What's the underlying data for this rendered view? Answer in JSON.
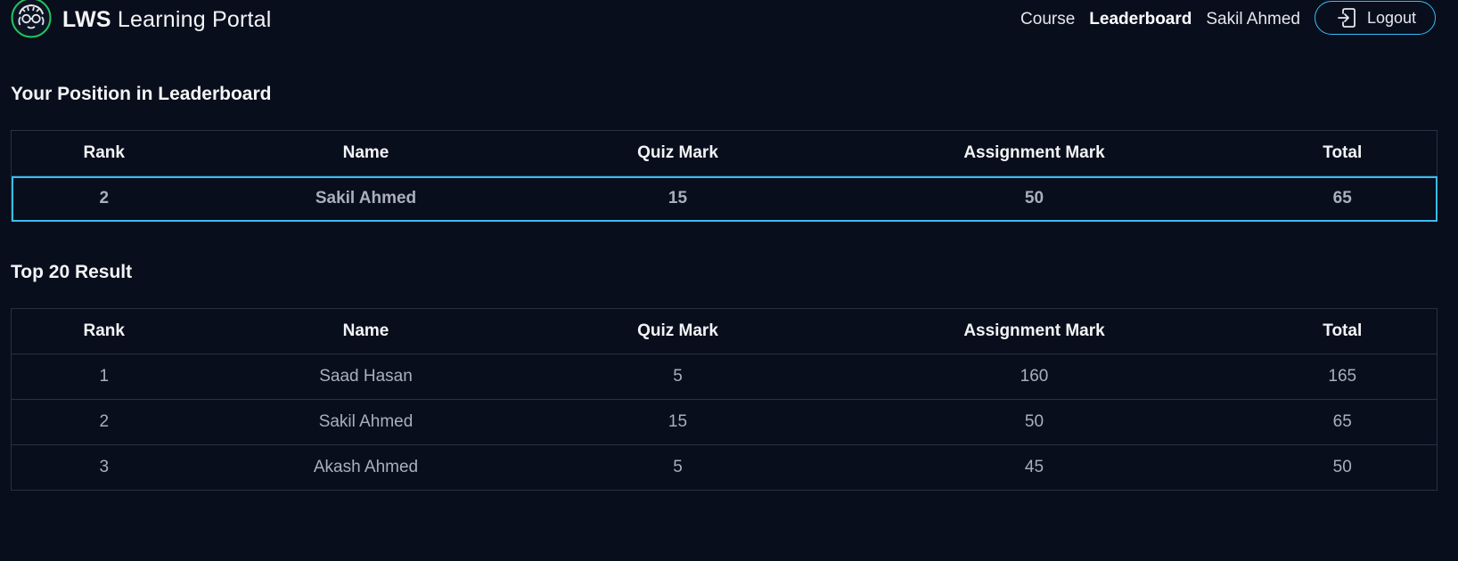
{
  "header": {
    "brand_bold": "LWS",
    "brand_rest": "Learning Portal",
    "logo_icon": "nerd-face-logo-icon",
    "nav": {
      "course_label": "Course",
      "leaderboard_label": "Leaderboard",
      "user_name": "Sakil Ahmed",
      "logout_label": "Logout"
    }
  },
  "position_section": {
    "title": "Your Position in Leaderboard",
    "columns": [
      "Rank",
      "Name",
      "Quiz Mark",
      "Assignment Mark",
      "Total"
    ],
    "row": {
      "rank": "2",
      "name": "Sakil Ahmed",
      "quiz": "15",
      "assignment": "50",
      "total": "65"
    }
  },
  "top_section": {
    "title": "Top 20 Result",
    "columns": [
      "Rank",
      "Name",
      "Quiz Mark",
      "Assignment Mark",
      "Total"
    ],
    "rows": [
      {
        "rank": "1",
        "name": "Saad Hasan",
        "quiz": "5",
        "assignment": "160",
        "total": "165"
      },
      {
        "rank": "2",
        "name": "Sakil Ahmed",
        "quiz": "15",
        "assignment": "50",
        "total": "65"
      },
      {
        "rank": "3",
        "name": "Akash Ahmed",
        "quiz": "5",
        "assignment": "45",
        "total": "50"
      }
    ]
  },
  "colors": {
    "background": "#080e1c",
    "accent": "#38bdf8",
    "logo_ring": "#22c55e",
    "border": "#283142"
  }
}
